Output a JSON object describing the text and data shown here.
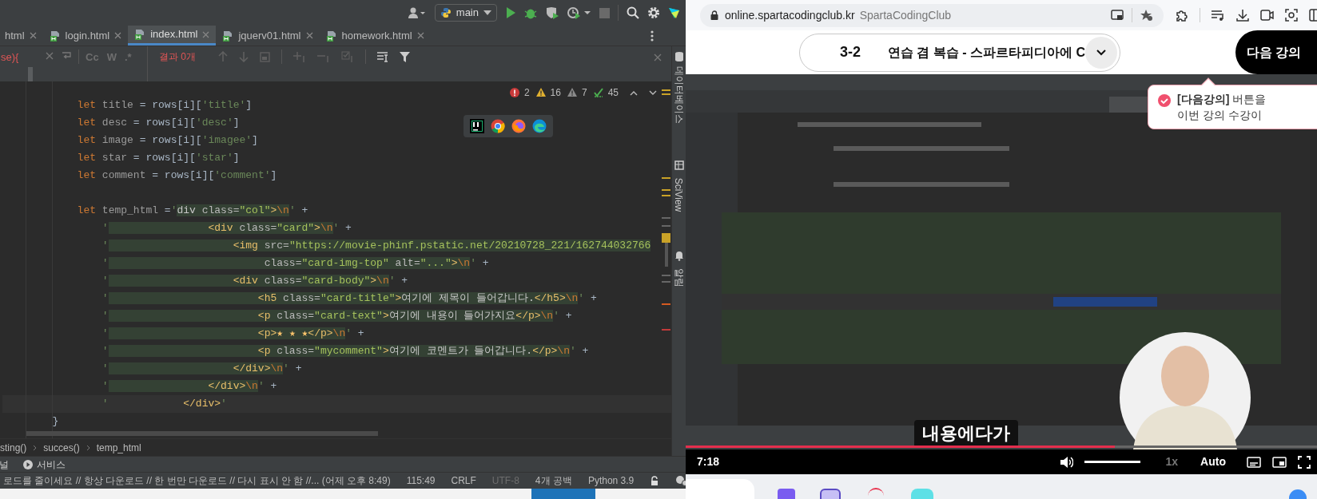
{
  "ide": {
    "toolbar": {
      "branch": "main"
    },
    "tabs": [
      {
        "label": "html",
        "selected": false
      },
      {
        "label": "login.html",
        "selected": false
      },
      {
        "label": "index.html",
        "selected": true
      },
      {
        "label": "jquerv01.html",
        "selected": false
      },
      {
        "label": "homework.html",
        "selected": false
      }
    ],
    "find_bar": {
      "query": "se){",
      "options": [
        "Cc",
        "W",
        ".*"
      ],
      "results": "결과 0개"
    },
    "inspections": [
      {
        "kind": "error",
        "count": "2"
      },
      {
        "kind": "warning",
        "count": "16"
      },
      {
        "kind": "weak",
        "count": "7"
      },
      {
        "kind": "typo",
        "count": "45"
      }
    ],
    "code_lines": [
      {
        "current": false,
        "tokens": [
          {
            "kind": "kw",
            "text": "            let"
          },
          {
            "kind": "ident",
            "text": " title"
          },
          {
            "kind": "plain",
            "text": " = rows[i]["
          },
          {
            "kind": "str",
            "text": "'title'"
          },
          {
            "kind": "plain",
            "text": "]"
          }
        ]
      },
      {
        "current": false,
        "tokens": [
          {
            "kind": "kw",
            "text": "            let"
          },
          {
            "kind": "ident",
            "text": " desc"
          },
          {
            "kind": "plain",
            "text": " = rows[i]["
          },
          {
            "kind": "str",
            "text": "'desc'"
          },
          {
            "kind": "plain",
            "text": "]"
          }
        ]
      },
      {
        "current": false,
        "tokens": [
          {
            "kind": "kw",
            "text": "            let"
          },
          {
            "kind": "ident",
            "text": " image"
          },
          {
            "kind": "plain",
            "text": " = rows[i]["
          },
          {
            "kind": "str",
            "text": "'imagee'"
          },
          {
            "kind": "plain",
            "text": "]"
          }
        ]
      },
      {
        "current": false,
        "tokens": [
          {
            "kind": "kw",
            "text": "            let"
          },
          {
            "kind": "ident",
            "text": " star"
          },
          {
            "kind": "plain",
            "text": " = rows[i]["
          },
          {
            "kind": "str",
            "text": "'star'"
          },
          {
            "kind": "plain",
            "text": "]"
          }
        ]
      },
      {
        "current": false,
        "tokens": [
          {
            "kind": "kw",
            "text": "            let"
          },
          {
            "kind": "ident",
            "text": " comment"
          },
          {
            "kind": "plain",
            "text": " = rows[i]["
          },
          {
            "kind": "str",
            "text": "'comment'"
          },
          {
            "kind": "plain",
            "text": "]"
          }
        ]
      },
      {
        "current": false
      },
      {
        "current": false,
        "tokens": [
          {
            "kind": "kw",
            "text": "            let"
          },
          {
            "kind": "ident",
            "text": " temp_html"
          },
          {
            "kind": "plain",
            "text": " ="
          },
          {
            "kind": "quote",
            "text": "'"
          },
          {
            "kind": "text",
            "text": "div"
          },
          {
            "kind": "attr",
            "text": " class="
          },
          {
            "kind": "value",
            "text": "\"col\""
          },
          {
            "kind": "tag",
            "text": ">"
          },
          {
            "kind": "esc",
            "text": "\\n"
          },
          {
            "kind": "quote",
            "text": "'"
          },
          {
            "kind": "plain",
            "text": " +"
          }
        ]
      },
      {
        "current": false,
        "tokens": [
          {
            "kind": "quote",
            "text": "                '"
          },
          {
            "kind": "tag",
            "text": "                <div"
          },
          {
            "kind": "attr",
            "text": " class="
          },
          {
            "kind": "value",
            "text": "\"card\""
          },
          {
            "kind": "tag",
            "text": ">"
          },
          {
            "kind": "esc",
            "text": "\\n"
          },
          {
            "kind": "quote",
            "text": "'"
          },
          {
            "kind": "plain",
            "text": " +"
          }
        ]
      },
      {
        "current": false,
        "tokens": [
          {
            "kind": "quote",
            "text": "                '"
          },
          {
            "kind": "tag",
            "text": "                    <img"
          },
          {
            "kind": "attr",
            "text": " src="
          },
          {
            "kind": "value",
            "text": "\"https://movie-phinf.pstatic.net/20210728_221/162744032766"
          }
        ]
      },
      {
        "current": false,
        "tokens": [
          {
            "kind": "quote",
            "text": "                '"
          },
          {
            "kind": "attr",
            "text": "                         class="
          },
          {
            "kind": "value",
            "text": "\"card-img-top\""
          },
          {
            "kind": "attr",
            "text": " alt="
          },
          {
            "kind": "value",
            "text": "\"...\""
          },
          {
            "kind": "tag",
            "text": ">"
          },
          {
            "kind": "esc",
            "text": "\\n"
          },
          {
            "kind": "quote",
            "text": "'"
          },
          {
            "kind": "plain",
            "text": " +"
          }
        ]
      },
      {
        "current": false,
        "tokens": [
          {
            "kind": "quote",
            "text": "                '"
          },
          {
            "kind": "tag",
            "text": "                    <div"
          },
          {
            "kind": "attr",
            "text": " class="
          },
          {
            "kind": "value",
            "text": "\"card-body\""
          },
          {
            "kind": "tag",
            "text": ">"
          },
          {
            "kind": "esc",
            "text": "\\n"
          },
          {
            "kind": "quote",
            "text": "'"
          },
          {
            "kind": "plain",
            "text": " +"
          }
        ]
      },
      {
        "current": false,
        "tokens": [
          {
            "kind": "quote",
            "text": "                '"
          },
          {
            "kind": "tag",
            "text": "                        <h5"
          },
          {
            "kind": "attr",
            "text": " class="
          },
          {
            "kind": "value",
            "text": "\"card-title\""
          },
          {
            "kind": "tag",
            "text": ">"
          },
          {
            "kind": "text",
            "text": "여기에 제목이 들어갑니다."
          },
          {
            "kind": "tag",
            "text": "</h5>"
          },
          {
            "kind": "esc",
            "text": "\\n"
          },
          {
            "kind": "quote",
            "text": "'"
          },
          {
            "kind": "plain",
            "text": " +"
          }
        ]
      },
      {
        "current": false,
        "tokens": [
          {
            "kind": "quote",
            "text": "                '"
          },
          {
            "kind": "tag",
            "text": "                        <p"
          },
          {
            "kind": "attr",
            "text": " class="
          },
          {
            "kind": "value",
            "text": "\"card-text\""
          },
          {
            "kind": "tag",
            "text": ">"
          },
          {
            "kind": "text",
            "text": "여기에 내용이 들어가지요"
          },
          {
            "kind": "tag",
            "text": "</p>"
          },
          {
            "kind": "esc",
            "text": "\\n"
          },
          {
            "kind": "quote",
            "text": "'"
          },
          {
            "kind": "plain",
            "text": " +"
          }
        ]
      },
      {
        "current": false,
        "tokens": [
          {
            "kind": "quote",
            "text": "                '"
          },
          {
            "kind": "tag",
            "text": "                        <p>"
          },
          {
            "kind": "star",
            "text": "★ ★ ★"
          },
          {
            "kind": "tag",
            "text": "</p>"
          },
          {
            "kind": "esc",
            "text": "\\n"
          },
          {
            "kind": "quote",
            "text": "'"
          },
          {
            "kind": "plain",
            "text": " +"
          }
        ]
      },
      {
        "current": false,
        "tokens": [
          {
            "kind": "quote",
            "text": "                '"
          },
          {
            "kind": "tag",
            "text": "                        <p"
          },
          {
            "kind": "attr",
            "text": " class="
          },
          {
            "kind": "value",
            "text": "\"mycomment\""
          },
          {
            "kind": "tag",
            "text": ">"
          },
          {
            "kind": "text",
            "text": "여기에 코멘트가 들어갑니다."
          },
          {
            "kind": "tag",
            "text": "</p>"
          },
          {
            "kind": "esc",
            "text": "\\n"
          },
          {
            "kind": "quote",
            "text": "'"
          },
          {
            "kind": "plain",
            "text": " +"
          }
        ]
      },
      {
        "current": false,
        "tokens": [
          {
            "kind": "quote",
            "text": "                '"
          },
          {
            "kind": "tag",
            "text": "                    </div>"
          },
          {
            "kind": "esc",
            "text": "\\n"
          },
          {
            "kind": "quote",
            "text": "'"
          },
          {
            "kind": "plain",
            "text": " +"
          }
        ]
      },
      {
        "current": false,
        "tokens": [
          {
            "kind": "quote",
            "text": "                '"
          },
          {
            "kind": "tag",
            "text": "                </div>"
          },
          {
            "kind": "esc",
            "text": "\\n"
          },
          {
            "kind": "quote",
            "text": "'"
          },
          {
            "kind": "plain",
            "text": " +"
          }
        ]
      },
      {
        "current": true,
        "tokens": [
          {
            "kind": "quote",
            "text": "                '"
          },
          {
            "kind": "tag",
            "text": "            </div>"
          },
          {
            "kind": "quote",
            "text": "'"
          }
        ]
      },
      {
        "current": false,
        "tokens": [
          {
            "kind": "plain",
            "text": "        }"
          }
        ]
      }
    ],
    "breadcrumbs": [
      "sting()",
      "succes()",
      "temp_html"
    ],
    "tool_windows": [
      "널",
      "서비스"
    ],
    "status_bar": {
      "message": "로드를 줄이세요 // 항상 다운로드 // 한 번만 다운로드 // 다시 표시 안 함 //... (어제 오후 8:49)",
      "items": [
        {
          "text": "115:49",
          "disabled": false
        },
        {
          "text": "CRLF",
          "disabled": false
        },
        {
          "text": "UTF-8",
          "disabled": true
        },
        {
          "text": "4개 공백",
          "disabled": false
        },
        {
          "text": "Python 3.9",
          "disabled": false
        }
      ]
    },
    "side_tools": [
      "데이터베이스",
      "SciView",
      "알림"
    ]
  },
  "browser": {
    "url": "online.spartacodingclub.kr",
    "site_name": "SpartaCodingClub"
  },
  "lecture": {
    "number": "3-2",
    "title": "연습 겸 복습 - 스파르타피디아에 C",
    "next_button": "다음 강의"
  },
  "notice": {
    "lines": [
      "**[다음강의]** 버튼을",
      "이번 강의 수강이"
    ]
  },
  "video": {
    "kind": "picture",
    "subtitle": "내용에다가",
    "time": "7:18",
    "progress": {
      "level": 0.68
    },
    "volume": {
      "level": 1
    },
    "speed": "1x",
    "quality": "Auto"
  }
}
